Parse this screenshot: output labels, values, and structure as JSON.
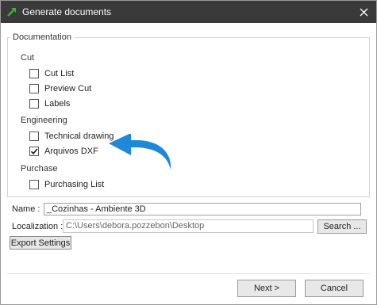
{
  "window": {
    "title": "Generate documents",
    "close_icon": "close-icon",
    "app_icon": "green-arrow-icon"
  },
  "documentation": {
    "legend": "Documentation",
    "sections": [
      {
        "title": "Cut",
        "items": [
          {
            "label": "Cut List",
            "checked": false
          },
          {
            "label": "Preview Cut",
            "checked": false
          },
          {
            "label": "Labels",
            "checked": false
          }
        ]
      },
      {
        "title": "Engineering",
        "items": [
          {
            "label": "Technical drawing",
            "checked": false
          },
          {
            "label": "Arquivos DXF",
            "checked": true
          }
        ]
      },
      {
        "title": "Purchase",
        "items": [
          {
            "label": "Purchasing List",
            "checked": false
          }
        ]
      }
    ]
  },
  "annotation": {
    "icon": "blue-curved-arrow-icon",
    "color": "#1e88d9"
  },
  "form": {
    "name_label": "Name :",
    "name_value": "_Cozinhas - Ambiente 3D",
    "localization_label": "Localization :",
    "localization_value": "C:\\Users\\debora.pozzebon\\Desktop",
    "search_label": "Search ...",
    "export_label": "Export Settings"
  },
  "footer": {
    "next_label": "Next >",
    "cancel_label": "Cancel"
  }
}
